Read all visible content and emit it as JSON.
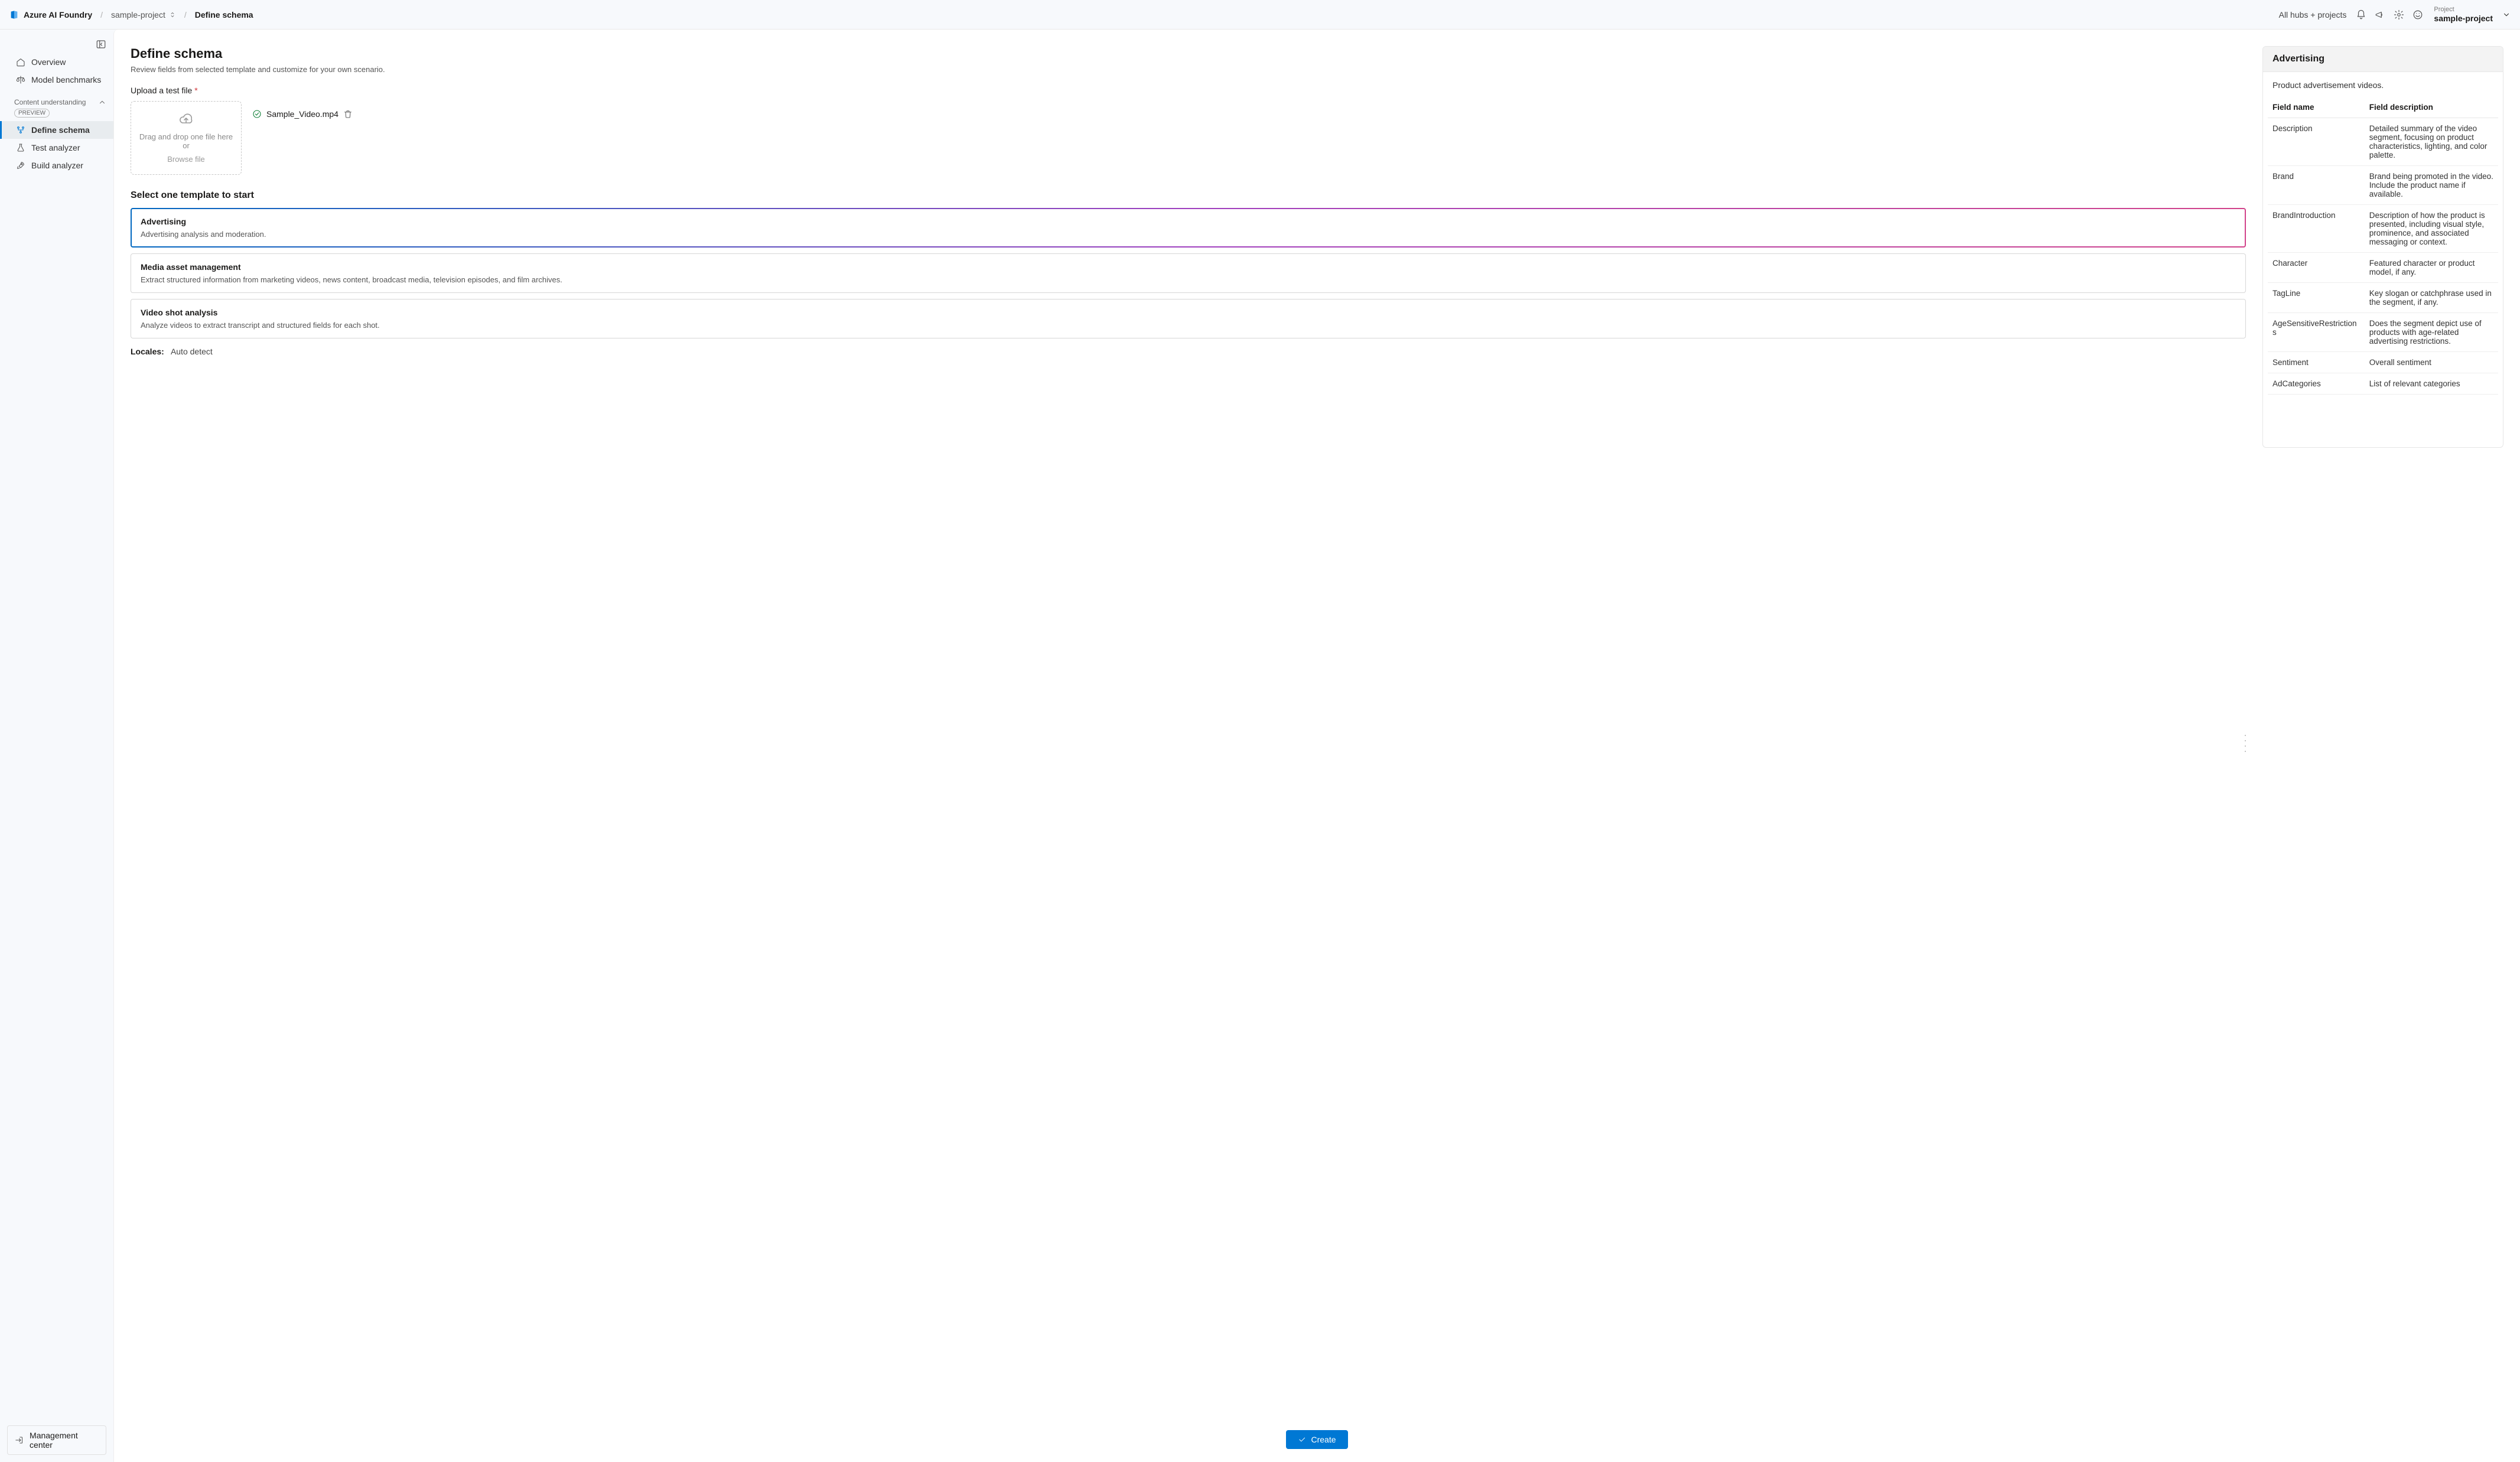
{
  "header": {
    "brand": "Azure AI Foundry",
    "breadcrumb": {
      "project": "sample-project",
      "page": "Define schema"
    },
    "all_hubs_label": "All hubs + projects",
    "project_switcher": {
      "label": "Project",
      "value": "sample-project"
    }
  },
  "sidebar": {
    "items": {
      "overview": "Overview",
      "model_benchmarks": "Model benchmarks"
    },
    "group": {
      "title": "Content understanding",
      "preview": "PREVIEW",
      "items": {
        "define_schema": "Define schema",
        "test_analyzer": "Test analyzer",
        "build_analyzer": "Build analyzer"
      }
    },
    "management_center": "Management center"
  },
  "page": {
    "title": "Define schema",
    "subtitle": "Review fields from selected template and customize for your own scenario.",
    "upload_label": "Upload a test file",
    "dropzone_line1": "Drag and drop one file here or",
    "dropzone_browse": "Browse file",
    "uploaded_file": "Sample_Video.mp4",
    "select_template_title": "Select one template to start",
    "templates": [
      {
        "title": "Advertising",
        "desc": "Advertising analysis and moderation.",
        "selected": true
      },
      {
        "title": "Media asset management",
        "desc": "Extract structured information from marketing videos, news content, broadcast media, television episodes, and film archives.",
        "selected": false
      },
      {
        "title": "Video shot analysis",
        "desc": "Analyze videos to extract transcript and structured fields for each shot.",
        "selected": false
      }
    ],
    "locales_label": "Locales:",
    "locales_value": "Auto detect",
    "create_button": "Create"
  },
  "detail": {
    "title": "Advertising",
    "subtitle": "Product advertisement videos.",
    "columns": {
      "name": "Field name",
      "desc": "Field description"
    },
    "fields": [
      {
        "name": "Description",
        "desc": "Detailed summary of the video segment, focusing on product characteristics, lighting, and color palette."
      },
      {
        "name": "Brand",
        "desc": "Brand being promoted in the video. Include the product name if available."
      },
      {
        "name": "BrandIntroduction",
        "desc": "Description of how the product is presented, including visual style, prominence, and associated messaging or context."
      },
      {
        "name": "Character",
        "desc": "Featured character or product model, if any."
      },
      {
        "name": "TagLine",
        "desc": "Key slogan or catchphrase used in the segment, if any."
      },
      {
        "name": "AgeSensitiveRestrictions",
        "desc": "Does the segment depict use of products with age-related advertising restrictions."
      },
      {
        "name": "Sentiment",
        "desc": "Overall sentiment"
      },
      {
        "name": "AdCategories",
        "desc": "List of relevant categories"
      }
    ]
  }
}
